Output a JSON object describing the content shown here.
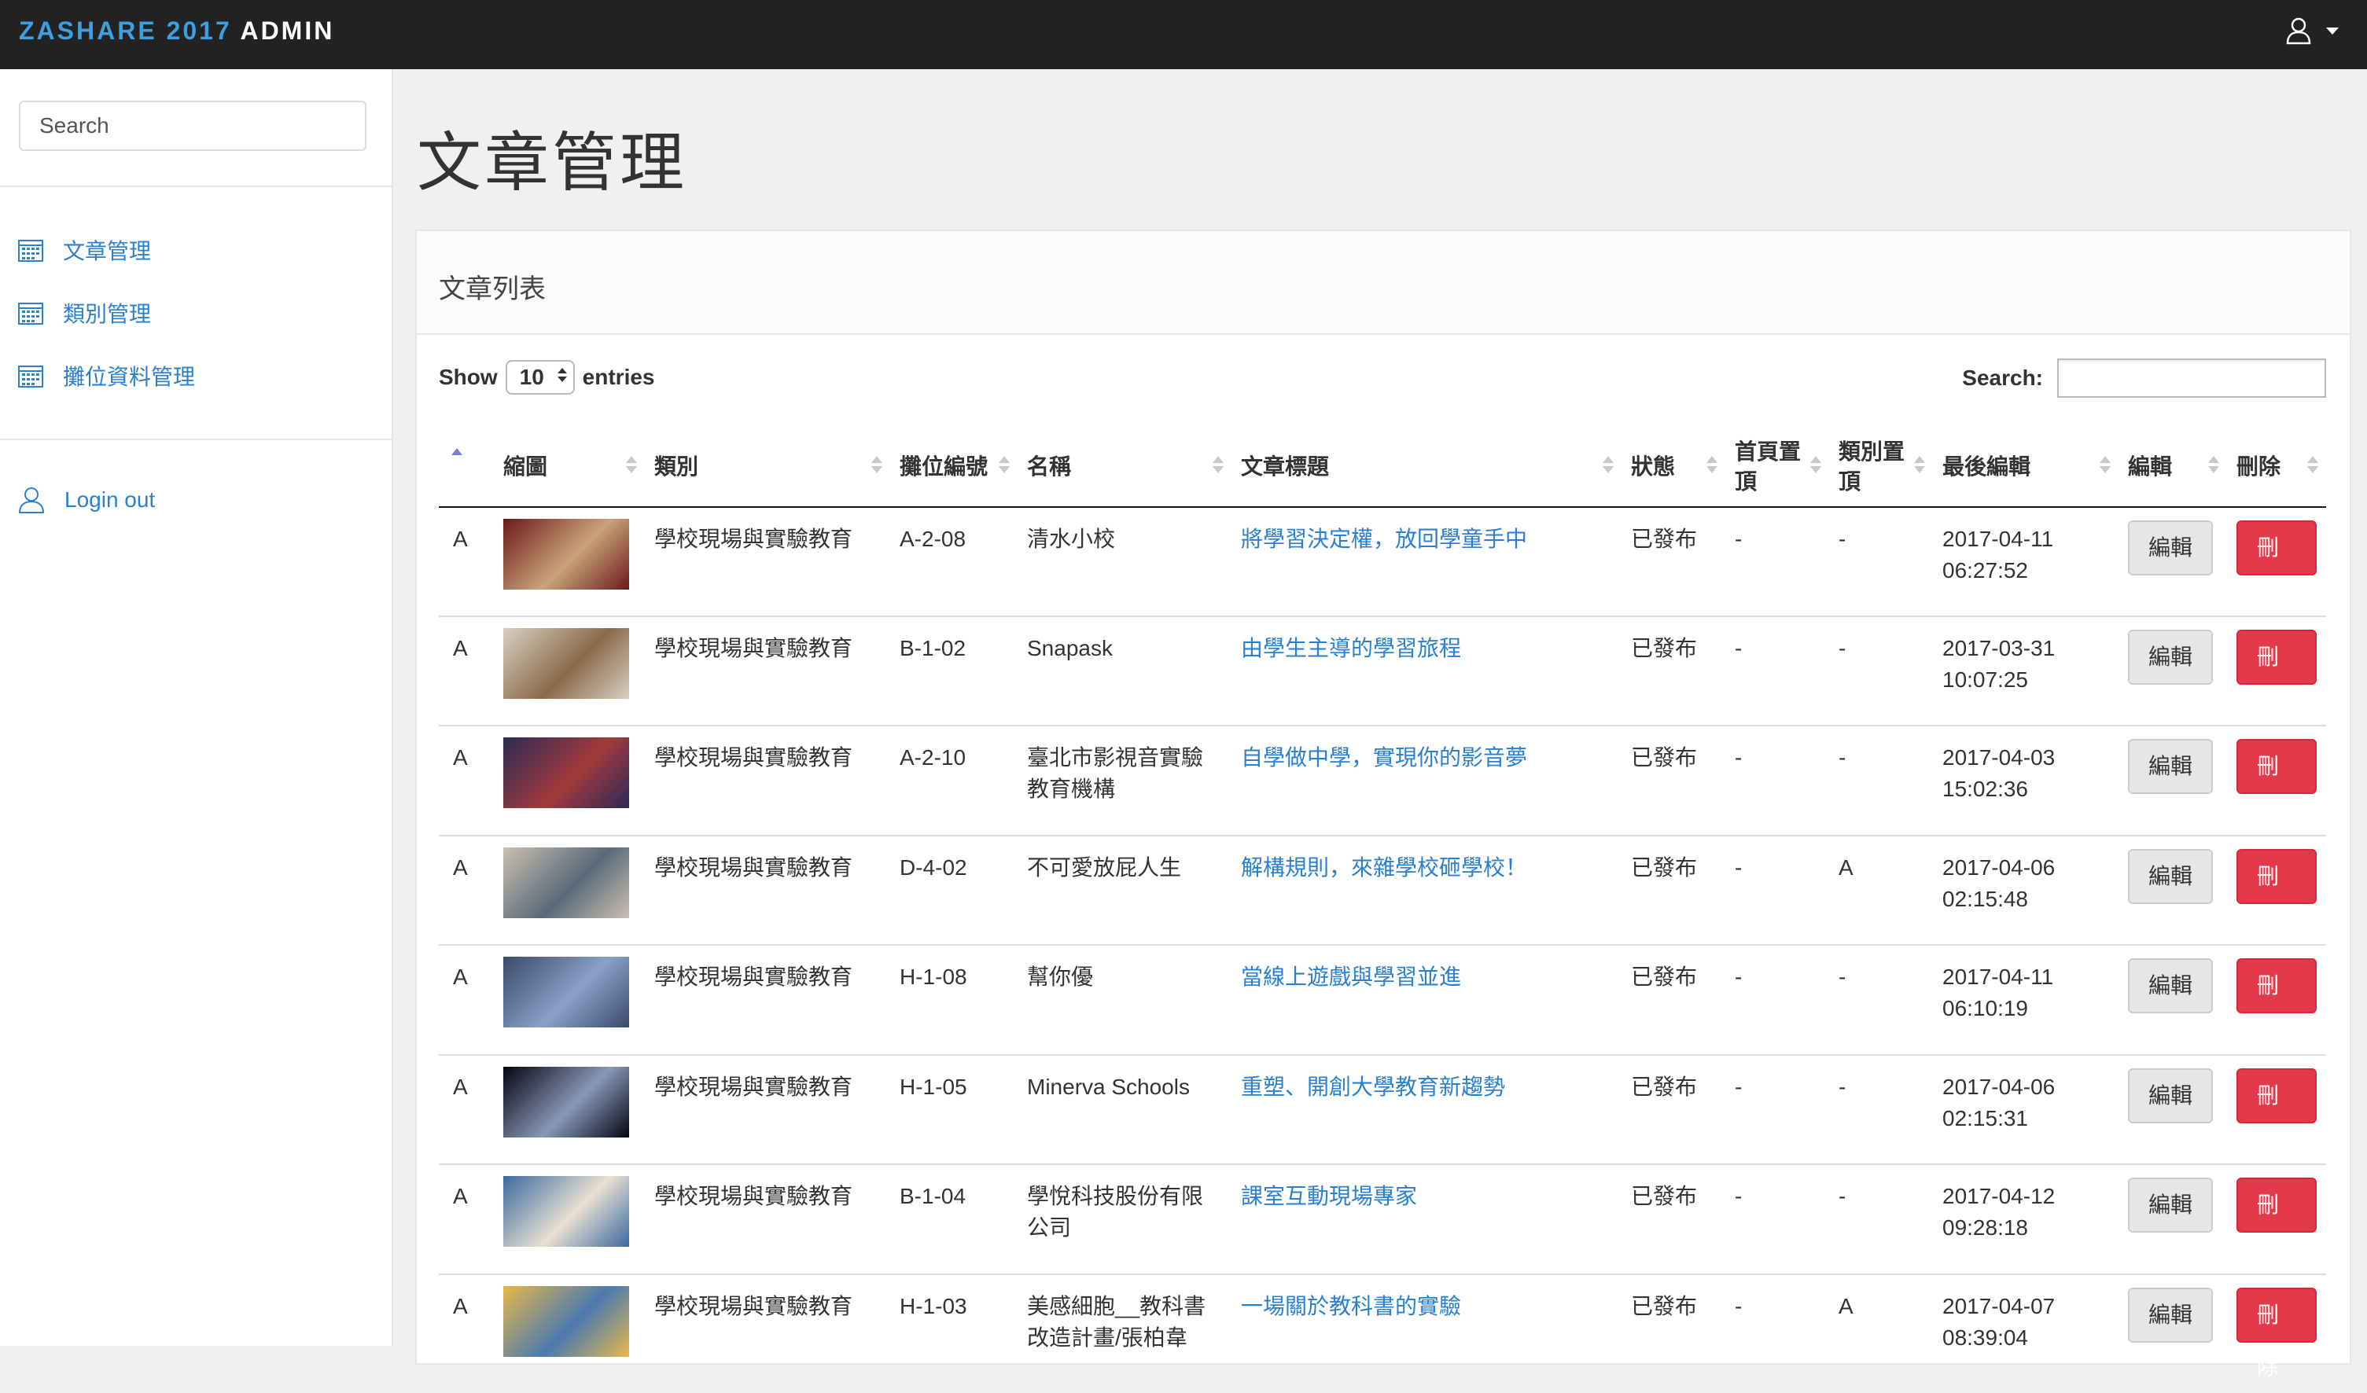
{
  "app": {
    "brand_prefix": "ZASHARE 2017",
    "brand_suffix": "ADMIN",
    "accent": "#3b9fe2"
  },
  "sidebar": {
    "search_placeholder": "Search",
    "items": [
      {
        "label": "文章管理",
        "icon": "calendar-icon"
      },
      {
        "label": "類別管理",
        "icon": "calendar-icon"
      },
      {
        "label": "攤位資料管理",
        "icon": "calendar-icon"
      }
    ],
    "logout": {
      "label": "Login out",
      "icon": "user-icon"
    }
  },
  "page": {
    "title": "文章管理"
  },
  "panel": {
    "title": "文章列表"
  },
  "table_controls": {
    "show_label": "Show",
    "page_length": "10",
    "entries_label": "entries",
    "search_label": "Search:"
  },
  "table": {
    "columns": [
      "縮圖",
      "類別",
      "攤位編號",
      "名稱",
      "文章標題",
      "狀態",
      "首頁置頂",
      "類別置頂",
      "最後編輯",
      "編輯",
      "刪除"
    ],
    "rows": [
      {
        "mark": "A",
        "category": "學校現場與實驗教育",
        "booth": "A-2-08",
        "name": "清水小校",
        "title": "將學習決定權，放回學童手中",
        "status": "已發布",
        "home_top": "-",
        "cat_top": "-",
        "date": "2017-04-11",
        "time": "06:27:52",
        "edit": "編輯",
        "delete": "刪除"
      },
      {
        "mark": "A",
        "category": "學校現場與實驗教育",
        "booth": "B-1-02",
        "name": "Snapask",
        "title": "由學生主導的學習旅程",
        "status": "已發布",
        "home_top": "-",
        "cat_top": "-",
        "date": "2017-03-31",
        "time": "10:07:25",
        "edit": "編輯",
        "delete": "刪除"
      },
      {
        "mark": "A",
        "category": "學校現場與實驗教育",
        "booth": "A-2-10",
        "name": "臺北市影視音實驗教育機構",
        "title": "自學做中學，實現你的影音夢",
        "status": "已發布",
        "home_top": "-",
        "cat_top": "-",
        "date": "2017-04-03",
        "time": "15:02:36",
        "edit": "編輯",
        "delete": "刪除"
      },
      {
        "mark": "A",
        "category": "學校現場與實驗教育",
        "booth": "D-4-02",
        "name": "不可愛放屁人生",
        "title": "解構規則，來雜學校砸學校！",
        "status": "已發布",
        "home_top": "-",
        "cat_top": "A",
        "date": "2017-04-06",
        "time": "02:15:48",
        "edit": "編輯",
        "delete": "刪除"
      },
      {
        "mark": "A",
        "category": "學校現場與實驗教育",
        "booth": "H-1-08",
        "name": "幫你優",
        "title": "當線上遊戲與學習並進",
        "status": "已發布",
        "home_top": "-",
        "cat_top": "-",
        "date": "2017-04-11",
        "time": "06:10:19",
        "edit": "編輯",
        "delete": "刪除"
      },
      {
        "mark": "A",
        "category": "學校現場與實驗教育",
        "booth": "H-1-05",
        "name": "Minerva Schools",
        "title": "重塑、開創大學教育新趨勢",
        "status": "已發布",
        "home_top": "-",
        "cat_top": "-",
        "date": "2017-04-06",
        "time": "02:15:31",
        "edit": "編輯",
        "delete": "刪除"
      },
      {
        "mark": "A",
        "category": "學校現場與實驗教育",
        "booth": "B-1-04",
        "name": "學悅科技股份有限公司",
        "title": "課室互動現場專家",
        "status": "已發布",
        "home_top": "-",
        "cat_top": "-",
        "date": "2017-04-12",
        "time": "09:28:18",
        "edit": "編輯",
        "delete": "刪除"
      },
      {
        "mark": "A",
        "category": "學校現場與實驗教育",
        "booth": "H-1-03",
        "name": "美感細胞__教科書改造計畫/張柏韋",
        "title": "一場關於教科書的實驗",
        "status": "已發布",
        "home_top": "-",
        "cat_top": "A",
        "date": "2017-04-07",
        "time": "08:39:04",
        "edit": "編輯",
        "delete": "刪除"
      }
    ]
  }
}
